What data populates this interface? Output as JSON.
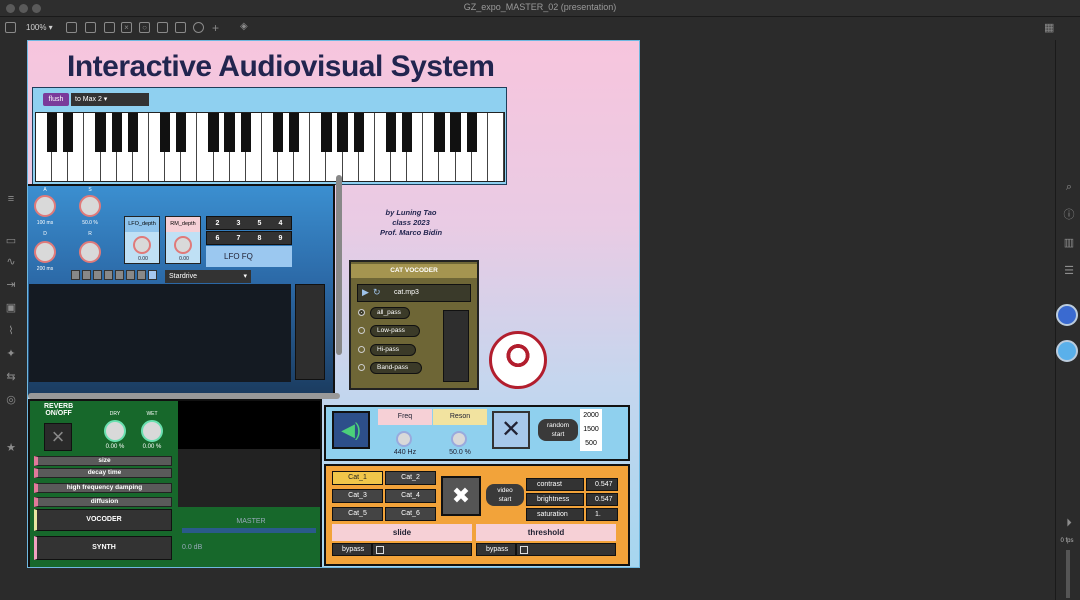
{
  "window": {
    "title": "GZ_expo_MASTER_02 (presentation)"
  },
  "toolbar": {
    "zoom": "100% ▾"
  },
  "patch": {
    "title": "Interactive Audiovisual System",
    "keyboard": {
      "flush_label": "flush",
      "output_menu": "to Max 2 ▾"
    },
    "envelope": {
      "a_label": "A",
      "a_value": "100 ms",
      "s_label": "S",
      "s_value": "50.0 %",
      "d_label": "D",
      "d_value": "200 ms",
      "r_label": "R"
    },
    "lfo": {
      "lfo_depth_label": "LFO_depth",
      "lfo_depth_value": "0.00",
      "rm_depth_label": "RM_depth",
      "rm_depth_value": "0.00",
      "grid_row1": [
        "2",
        "3",
        "5",
        "4"
      ],
      "grid_row2": [
        "6",
        "7",
        "8",
        "9"
      ],
      "lfo_fq_label": "LFO FQ"
    },
    "preset_menu": "Stardrive",
    "credits": {
      "line1": "by Luning Tao",
      "line2": "class 2023",
      "line3": "Prof. Marco Bidin"
    },
    "cat_vocoder": {
      "title": "CAT VOCODER",
      "file": "cat.mp3",
      "filters": [
        "all_pass",
        "Low-pass",
        "Hi-pass",
        "Band-pass"
      ],
      "selected": "all_pass"
    },
    "reverb": {
      "title_line1": "REVERB",
      "title_line2": "ON/OFF",
      "dry_label": "DRY",
      "dry_value": "0.00 %",
      "wet_label": "WET",
      "wet_value": "0.00 %",
      "params": [
        "size",
        "decay time",
        "high frequency damping",
        "diffusion"
      ],
      "vocoder_label": "VOCODER",
      "synth_label": "SYNTH",
      "master_label": "MASTER",
      "master_value": "0.0 dB"
    },
    "filter": {
      "freq_label": "Freq",
      "freq_value": "440 Hz",
      "reson_label": "Reson",
      "reson_value": "50.0 %",
      "random_label_1": "random",
      "random_label_2": "start",
      "values": [
        "2000",
        "1500",
        "500"
      ]
    },
    "video": {
      "cats": [
        "Cat_1",
        "Cat_2",
        "Cat_3",
        "Cat_4",
        "Cat_5",
        "Cat_6"
      ],
      "video_label_1": "video",
      "video_label_2": "start",
      "contrast_label": "contrast",
      "contrast_value": "0.547",
      "brightness_label": "brightness",
      "brightness_value": "0.547",
      "saturation_label": "saturation",
      "saturation_value": "1.",
      "slide_label": "slide",
      "threshold_label": "threshold",
      "bypass_label": "bypass"
    }
  },
  "status": {
    "fps": "0 fps"
  },
  "colors": {
    "accent": "#7a3a9a",
    "reverb_green": "#17682b",
    "video_orange": "#f2a33a",
    "logo_red": "#b21e2e"
  }
}
